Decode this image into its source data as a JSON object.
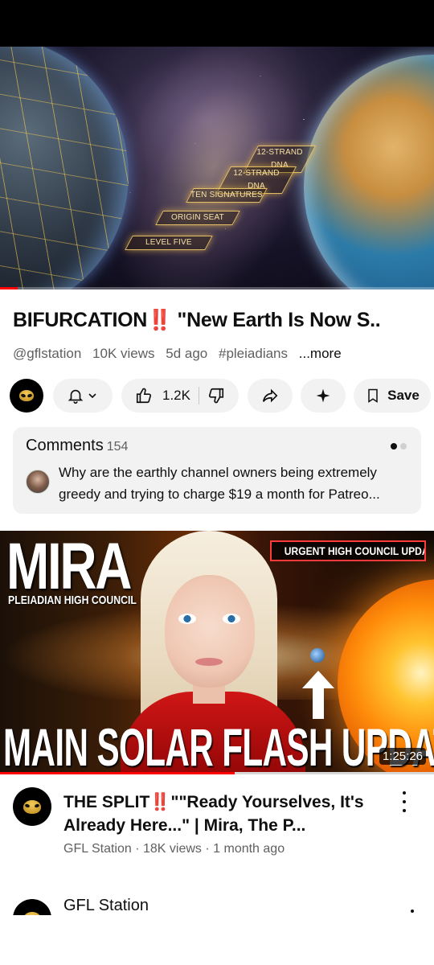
{
  "video": {
    "thumbnail_steps": [
      "12-STRAND DNA",
      "12-STRAND DNA",
      "TEN SIGNATURES",
      "ORIGIN SEAT",
      "LEVEL FIVE"
    ],
    "progress_fraction": 0.04,
    "title_text": "BIFURCATION",
    "title_emoji": "‼️",
    "title_rest": " \"New Earth Is Now S..",
    "channel_handle": "@gflstation",
    "views": "10K views",
    "age": "5d ago",
    "hashtag": "#pleiadians",
    "more_label": "...more"
  },
  "actions": {
    "subscribe_icon": "bell-icon",
    "likes": "1.2K",
    "save_label": "Save"
  },
  "comments": {
    "label": "Comments",
    "count": "154",
    "top_comment": "Why are the earthly channel owners being extremely greedy and trying to charge $19 a month for Patreo..."
  },
  "next_video": {
    "thumb_name": "MIRA",
    "thumb_sub": "PLEIADIAN HIGH COUNCIL",
    "thumb_badge": "URGENT HIGH COUNCIL UPDATE",
    "thumb_headline": "MAIN SOLAR FLASH UPDATE",
    "duration": "1:25:26",
    "watched_fraction": 0.54,
    "title_start": "THE SPLIT",
    "title_emoji": "‼️",
    "title_rest": "\"\"Ready Yourselves, It's Already Here...\" | Mira, The P...",
    "meta": "GFL Station · 18K views · 1 month ago"
  },
  "next_item": {
    "channel": "GFL Station"
  },
  "colors": {
    "accent_red": "#ff0000",
    "pill_bg": "#f2f2f2",
    "secondary_text": "#606060"
  }
}
